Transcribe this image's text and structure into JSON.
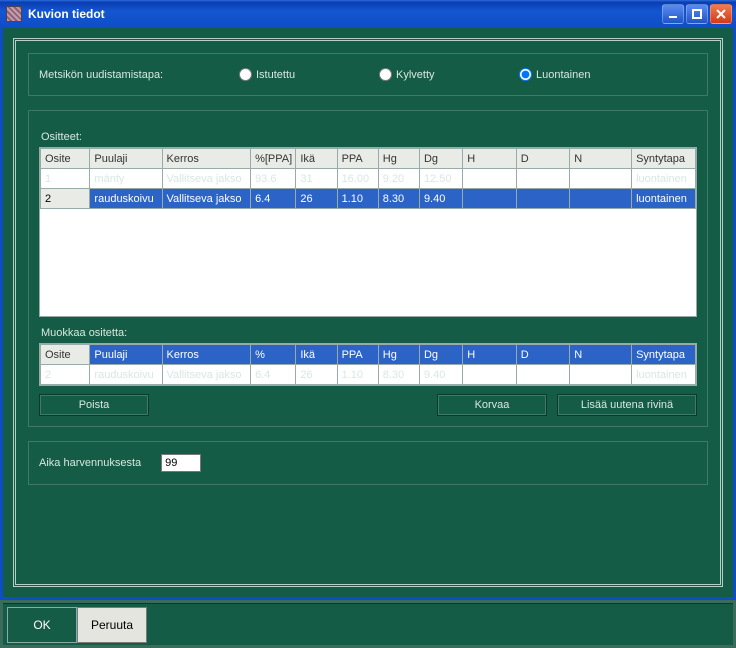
{
  "window": {
    "title": "Kuvion tiedot"
  },
  "regen": {
    "label": "Metsikön uudistamistapa:",
    "options": {
      "planted": "Istutettu",
      "sown": "Kylvetty",
      "natural": "Luontainen"
    },
    "selected": "natural"
  },
  "ositteet": {
    "title": "Ositteet:",
    "headers": {
      "osite": "Osite",
      "puulaji": "Puulaji",
      "kerros": "Kerros",
      "pct": "%[PPA]",
      "ika": "Ikä",
      "ppa": "PPA",
      "hg": "Hg",
      "dg": "Dg",
      "h": "H",
      "d": "D",
      "n": "N",
      "syntytapa": "Syntytapa"
    },
    "rows": [
      {
        "osite": "1",
        "puulaji": "mänty",
        "kerros": "Vallitseva jakso",
        "pct": "93.6",
        "ika": "31",
        "ppa": "16.00",
        "hg": "9.20",
        "dg": "12.50",
        "h": "",
        "d": "",
        "n": "",
        "syntytapa": "luontainen",
        "selected": false
      },
      {
        "osite": "2",
        "puulaji": "rauduskoivu",
        "kerros": "Vallitseva jakso",
        "pct": "6.4",
        "ika": "26",
        "ppa": "1.10",
        "hg": "8.30",
        "dg": "9.40",
        "h": "",
        "d": "",
        "n": "",
        "syntytapa": "luontainen",
        "selected": true
      }
    ]
  },
  "muokkaa": {
    "title": "Muokkaa ositetta:",
    "headers": {
      "osite": "Osite",
      "puulaji": "Puulaji",
      "kerros": "Kerros",
      "pct": "%",
      "ika": "Ikä",
      "ppa": "PPA",
      "hg": "Hg",
      "dg": "Dg",
      "h": "H",
      "d": "D",
      "n": "N",
      "syntytapa": "Syntytapa"
    },
    "row": {
      "osite": "2",
      "puulaji": "rauduskoivu",
      "kerros": "Vallitseva jakso",
      "pct": "6.4",
      "ika": "26",
      "ppa": "1.10",
      "hg": "8.30",
      "dg": "9.40",
      "h": "",
      "d": "",
      "n": "",
      "syntytapa": "luontainen"
    }
  },
  "buttons": {
    "poista": "Poista",
    "korvaa": "Korvaa",
    "lisaa": "Lisää uutena rivinä"
  },
  "aika": {
    "label": "Aika harvennuksesta",
    "value": "99"
  },
  "footer": {
    "ok": "OK",
    "cancel": "Peruuta"
  }
}
